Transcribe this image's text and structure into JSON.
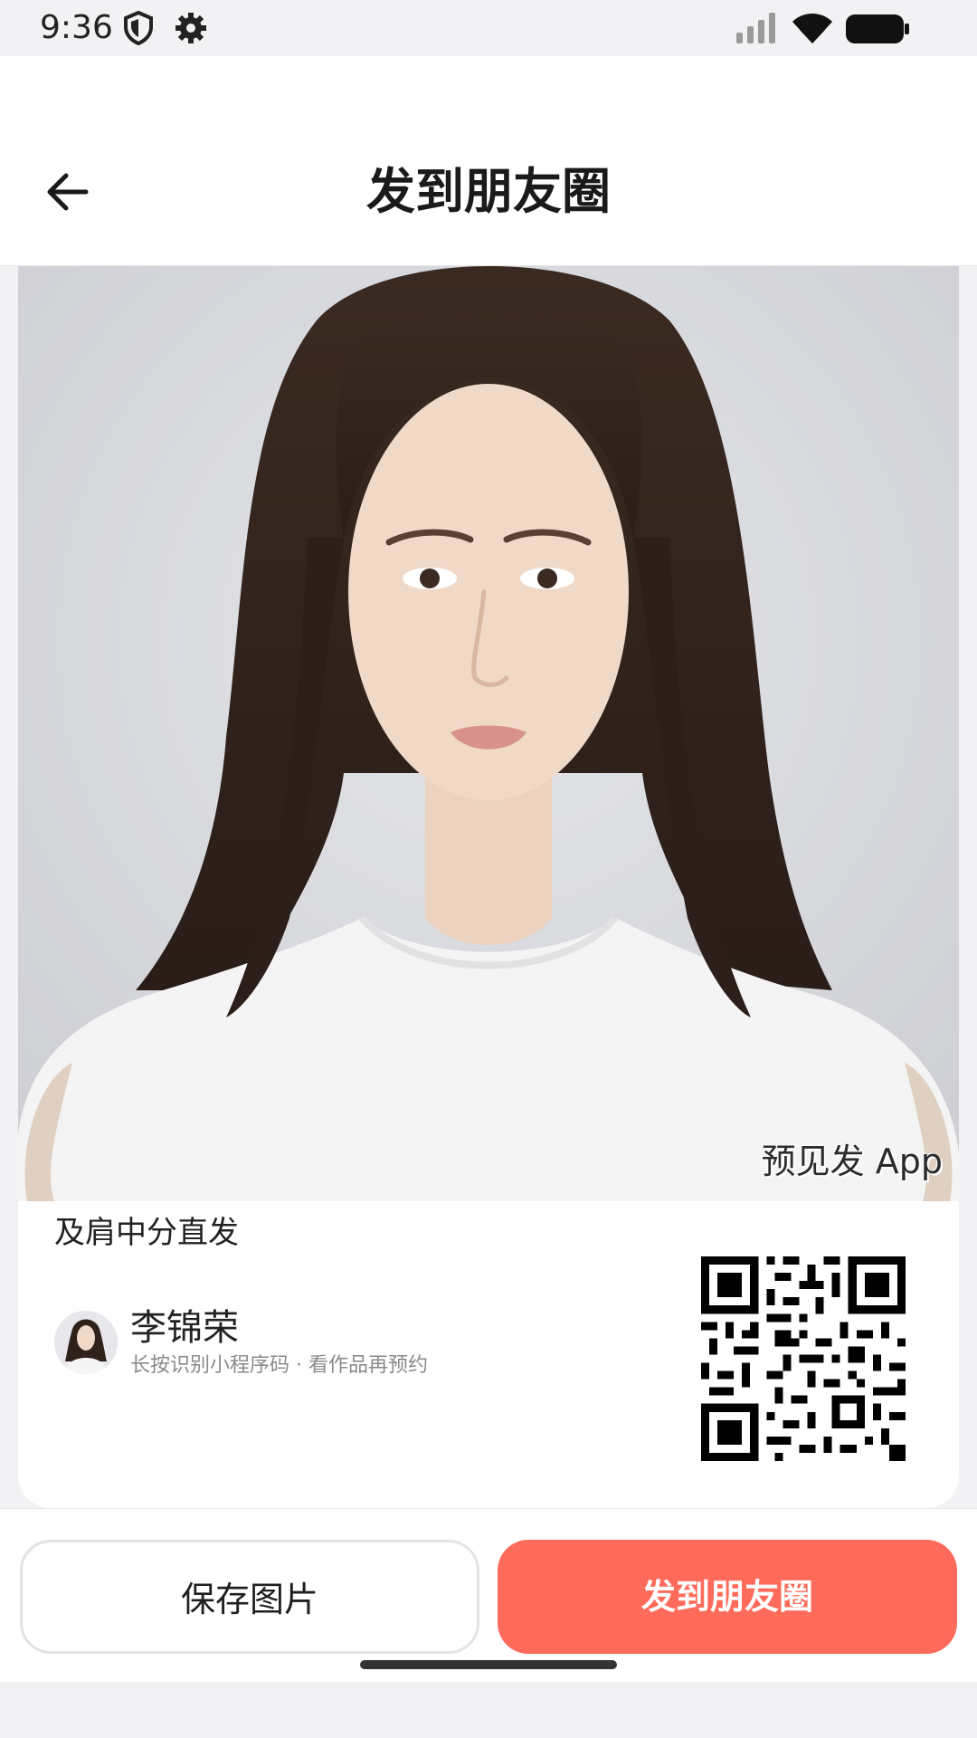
{
  "status_bar": {
    "time": "9:36",
    "icons": [
      "shield-icon",
      "gear-icon",
      "signal-icon",
      "wifi-icon",
      "battery-icon"
    ]
  },
  "nav": {
    "title": "发到朋友圈",
    "back_icon": "arrow-left-icon"
  },
  "card": {
    "watermark": "预见发 App",
    "caption": "及肩中分直发",
    "author": {
      "name": "李锦荣",
      "hint": "长按识别小程序码 · 看作品再预约"
    }
  },
  "actions": {
    "save_label": "保存图片",
    "share_label": "发到朋友圈"
  },
  "colors": {
    "accent": "#ff6b5a",
    "background": "#f2f2f4",
    "card": "#ffffff",
    "text_primary": "#222222",
    "text_secondary": "#8a8a8a"
  }
}
